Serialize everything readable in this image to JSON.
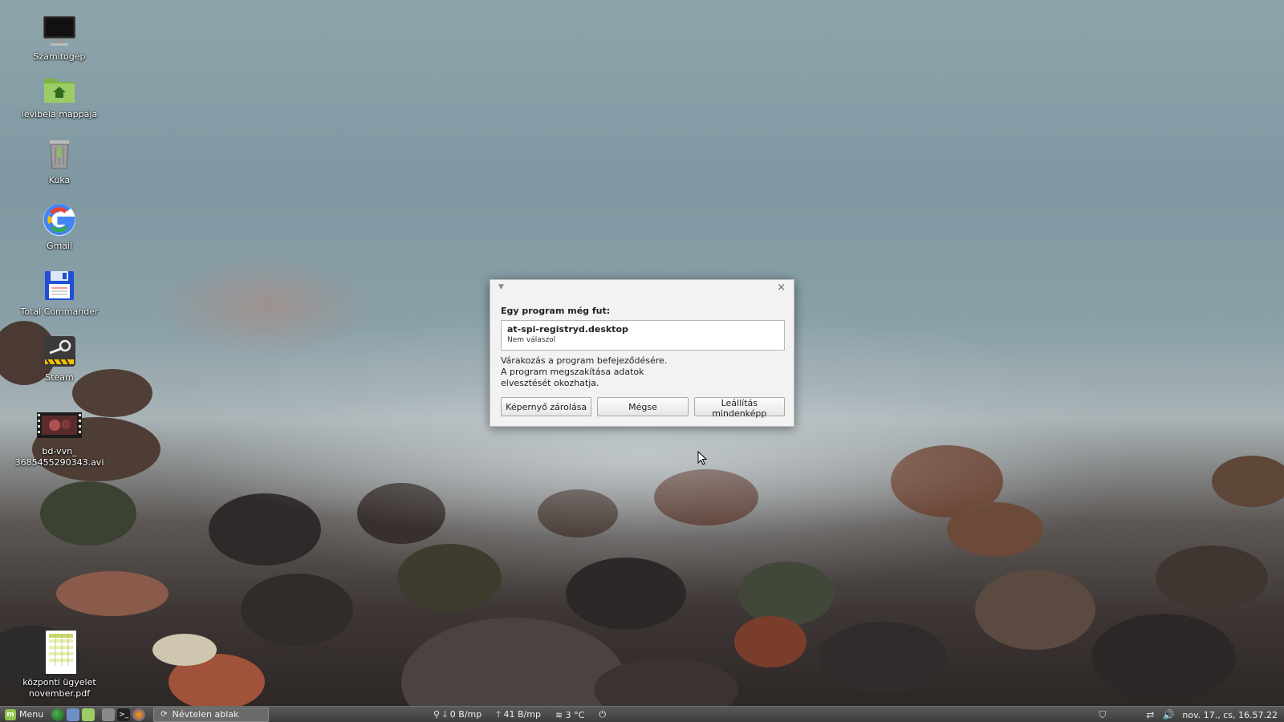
{
  "desktop": {
    "icons": [
      {
        "label": "Számítógép",
        "icon": "monitor-icon"
      },
      {
        "label": "levibela mappája",
        "icon": "home-folder-icon"
      },
      {
        "label": "Kuka",
        "icon": "trash-icon"
      },
      {
        "label": "Gmail",
        "icon": "google-icon"
      },
      {
        "label": "Total Commander",
        "icon": "floppy-icon"
      },
      {
        "label": "Steam",
        "icon": "steam-icon"
      },
      {
        "label": "bd-vvn_",
        "label2": "3685455290343.avi",
        "icon": "video-icon"
      },
      {
        "label": "központi ügyelet",
        "label2": "november.pdf",
        "icon": "pdf-icon"
      }
    ]
  },
  "dialog": {
    "heading": "Egy program még fut:",
    "process_name": "at-spi-registryd.desktop",
    "process_status": "Nem válaszol",
    "message": "Várakozás a program befejeződésére. A program megszakítása adatok elvesztését okozhatja.",
    "buttons": {
      "lock": "Képernyő zárolása",
      "cancel": "Mégse",
      "force": "Leállítás mindenképp"
    },
    "close_glyph": "×"
  },
  "taskbar": {
    "menu_label": "Menu",
    "window_title": "Névtelen ablak",
    "net_down": "0 B/mp",
    "net_up": "41 B/mp",
    "temperature": "3 °C",
    "clock": "nov. 17., cs, 16.57.22"
  },
  "colors": {
    "accent": "#8fc34a",
    "google_red": "#ea4335",
    "google_blue": "#4285f4",
    "google_yellow": "#fbbc05",
    "google_green": "#34a853"
  }
}
